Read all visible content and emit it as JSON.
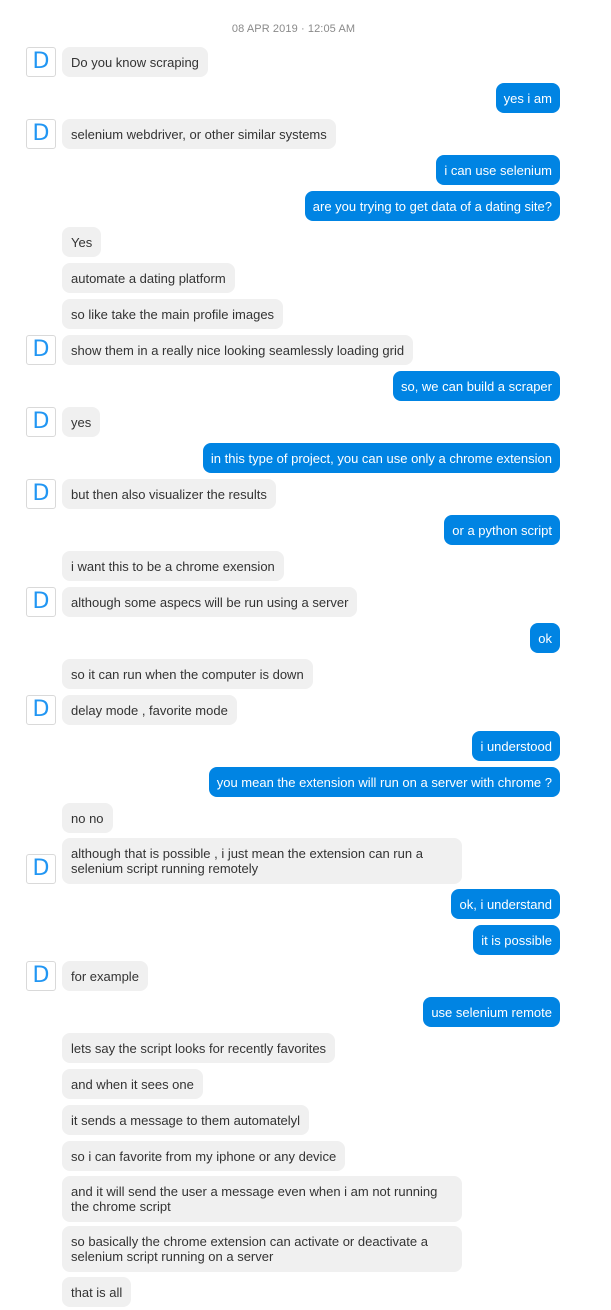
{
  "timestamp": "08 APR 2019 · 12:05 AM",
  "avatar_letter": "D",
  "colors": {
    "incoming_bubble": "#f0f0f0",
    "outgoing_bubble": "#0084e3",
    "avatar_letter": "#2196f3"
  },
  "messages": [
    {
      "dir": "in",
      "avatar": true,
      "text": "Do you know scraping"
    },
    {
      "dir": "out",
      "text": "yes i am"
    },
    {
      "dir": "in",
      "avatar": true,
      "text": "selenium webdriver, or other similar systems"
    },
    {
      "dir": "out",
      "text": "i can use selenium"
    },
    {
      "dir": "out",
      "text": "are you trying to get data of a dating site?"
    },
    {
      "dir": "in",
      "avatar": false,
      "text": "Yes"
    },
    {
      "dir": "in",
      "avatar": false,
      "text": "automate a dating platform"
    },
    {
      "dir": "in",
      "avatar": false,
      "text": "so like take the main profile images"
    },
    {
      "dir": "in",
      "avatar": true,
      "text": "show them in a really nice looking seamlessly loading grid"
    },
    {
      "dir": "out",
      "text": "so, we can build a scraper"
    },
    {
      "dir": "in",
      "avatar": true,
      "text": "yes"
    },
    {
      "dir": "out",
      "text": "in this type of project, you can use only a chrome extension"
    },
    {
      "dir": "in",
      "avatar": true,
      "text": "but then also visualizer the results"
    },
    {
      "dir": "out",
      "text": "or a python script"
    },
    {
      "dir": "in",
      "avatar": false,
      "text": "i want this to be a chrome exension"
    },
    {
      "dir": "in",
      "avatar": true,
      "text": "although some aspecs will be run using a server"
    },
    {
      "dir": "out",
      "text": "ok"
    },
    {
      "dir": "in",
      "avatar": false,
      "text": "so it can run when the computer is down"
    },
    {
      "dir": "in",
      "avatar": true,
      "text": "delay mode , favorite mode"
    },
    {
      "dir": "out",
      "text": "i understood"
    },
    {
      "dir": "out",
      "text": "you mean the extension will run on a server with chrome ?"
    },
    {
      "dir": "in",
      "avatar": false,
      "text": "no no"
    },
    {
      "dir": "in",
      "avatar": true,
      "multi": true,
      "text": "although that is possible , i just mean the extension can run a selenium script running remotely"
    },
    {
      "dir": "out",
      "text": "ok, i understand"
    },
    {
      "dir": "out",
      "text": "it is possible"
    },
    {
      "dir": "in",
      "avatar": true,
      "text": "for example"
    },
    {
      "dir": "out",
      "text": "use selenium remote"
    },
    {
      "dir": "in",
      "avatar": false,
      "text": "lets say the script looks for recently favorites"
    },
    {
      "dir": "in",
      "avatar": false,
      "text": "and when it sees one"
    },
    {
      "dir": "in",
      "avatar": false,
      "text": "it sends a message to them automatelyl"
    },
    {
      "dir": "in",
      "avatar": false,
      "text": "so i can favorite from my iphone or any device"
    },
    {
      "dir": "in",
      "avatar": false,
      "multi": true,
      "text": "and it will send the user a message even when i am not running the chrome script"
    },
    {
      "dir": "in",
      "avatar": false,
      "multi": true,
      "text": "so basically the chrome extension can activate or deactivate a selenium script running on a server"
    },
    {
      "dir": "in",
      "avatar": false,
      "text": "that is all"
    }
  ]
}
